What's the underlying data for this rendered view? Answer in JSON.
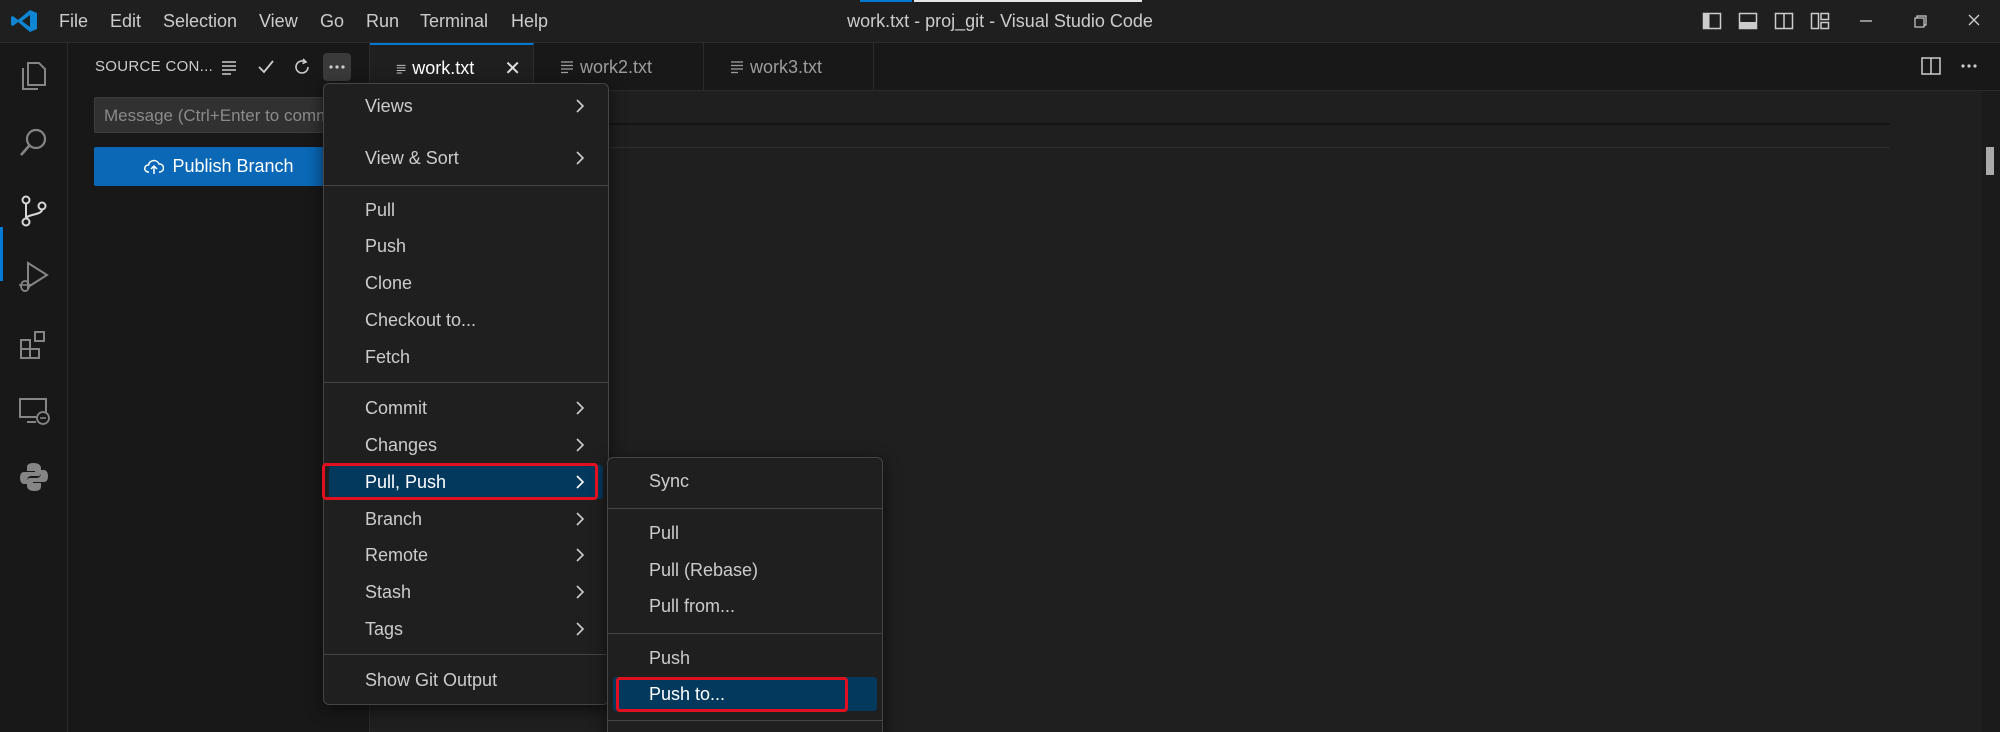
{
  "window": {
    "title": "work.txt - proj_git - Visual Studio Code",
    "menu": [
      "File",
      "Edit",
      "Selection",
      "View",
      "Go",
      "Run",
      "Terminal",
      "Help"
    ]
  },
  "activity_bar": {
    "items": [
      "explorer-icon",
      "search-icon",
      "source-control-icon",
      "run-debug-icon",
      "extensions-icon",
      "remote-explorer-icon",
      "python-icon"
    ],
    "active": "source-control-icon"
  },
  "sidebar": {
    "title": "SOURCE CON...",
    "message_placeholder": "Message (Ctrl+Enter to commit on 'master')",
    "publish_label": "Publish Branch"
  },
  "tabs": [
    {
      "label": "work.txt",
      "active": true
    },
    {
      "label": "work2.txt",
      "active": false
    },
    {
      "label": "work3.txt",
      "active": false
    }
  ],
  "context_menu": {
    "items": [
      {
        "label": "Views",
        "submenu": true
      },
      {
        "label": "View & Sort",
        "submenu": true
      },
      {
        "label": "Pull"
      },
      {
        "label": "Push"
      },
      {
        "label": "Clone"
      },
      {
        "label": "Checkout to..."
      },
      {
        "label": "Fetch"
      },
      {
        "label": "Commit",
        "submenu": true
      },
      {
        "label": "Changes",
        "submenu": true
      },
      {
        "label": "Pull, Push",
        "submenu": true,
        "selected": true
      },
      {
        "label": "Branch",
        "submenu": true
      },
      {
        "label": "Remote",
        "submenu": true
      },
      {
        "label": "Stash",
        "submenu": true
      },
      {
        "label": "Tags",
        "submenu": true
      },
      {
        "label": "Show Git Output"
      }
    ]
  },
  "submenu": {
    "items": [
      {
        "label": "Sync"
      },
      {
        "label": "Pull"
      },
      {
        "label": "Pull (Rebase)"
      },
      {
        "label": "Pull from..."
      },
      {
        "label": "Push"
      },
      {
        "label": "Push to...",
        "selected": true
      }
    ]
  },
  "colors": {
    "accent": "#0078d4",
    "selection": "#04395e",
    "button": "#0a68b6",
    "highlight_box": "#e0101e"
  }
}
